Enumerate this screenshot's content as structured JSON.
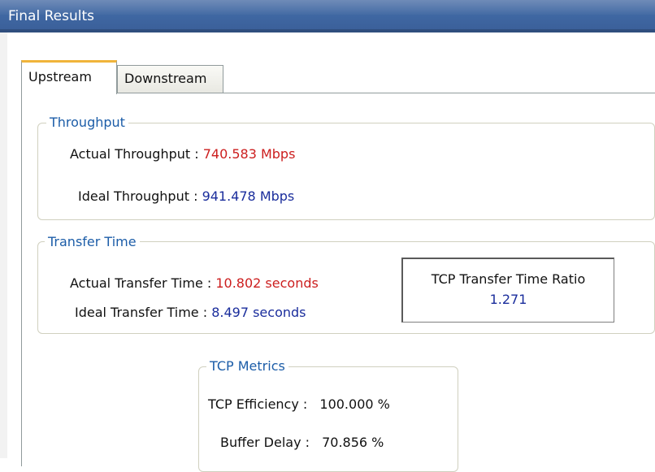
{
  "window": {
    "title": "Final Results"
  },
  "tabs": [
    {
      "label": "Upstream",
      "selected": true
    },
    {
      "label": "Downstream",
      "selected": false
    }
  ],
  "throughput": {
    "legend": "Throughput",
    "actual_label": "Actual Throughput :",
    "actual_value": "740.583 Mbps",
    "ideal_label": "Ideal Throughput :",
    "ideal_value": "941.478 Mbps"
  },
  "transfer_time": {
    "legend": "Transfer Time",
    "actual_label": "Actual Transfer Time :",
    "actual_value": "10.802 seconds",
    "ideal_label": "Ideal Transfer Time  :",
    "ideal_value": "8.497 seconds",
    "ratio_title": "TCP Transfer Time Ratio",
    "ratio_value": "1.271"
  },
  "tcp_metrics": {
    "legend": "TCP Metrics",
    "efficiency_label": "TCP Efficiency :",
    "efficiency_value": "100.000 %",
    "buffer_delay_label": "Buffer Delay :",
    "buffer_delay_value": "70.856 %"
  },
  "colors": {
    "titlebar": "#3f67a2",
    "legend_text": "#1c5da8",
    "actual_value": "#cc1e1e",
    "ideal_value": "#1a2d9c",
    "active_tab_accent": "#f0b43b"
  }
}
